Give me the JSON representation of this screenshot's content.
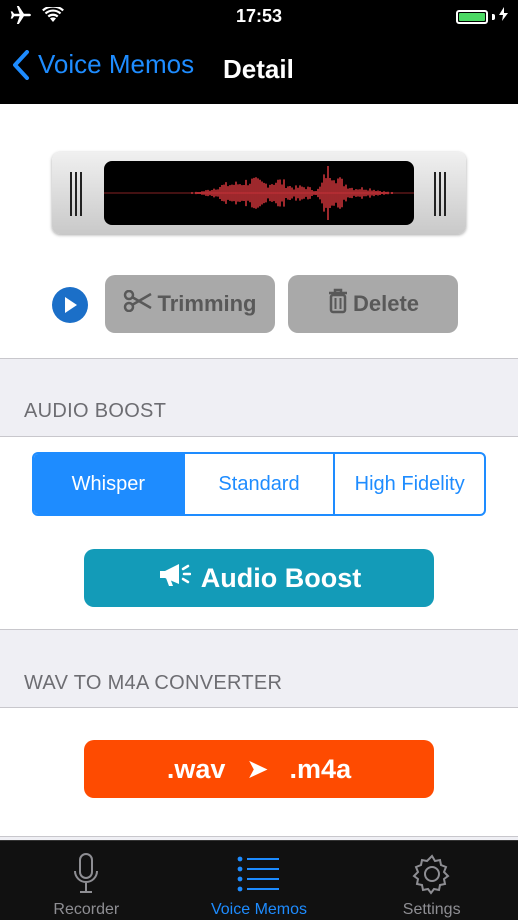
{
  "status_bar": {
    "time": "17:53"
  },
  "nav": {
    "back_label": "Voice Memos",
    "title": "Detail"
  },
  "controls": {
    "trim_label": "Trimming",
    "delete_label": "Delete"
  },
  "audio_boost": {
    "header": "AUDIO BOOST",
    "modes": [
      "Whisper",
      "Standard",
      "High Fidelity"
    ],
    "selected_mode": "Whisper",
    "button_label": "Audio Boost"
  },
  "converter": {
    "header": "WAV TO M4A CONVERTER",
    "from_label": ".wav",
    "arrow": "➤",
    "to_label": ".m4a"
  },
  "tabs": [
    {
      "label": "Recorder",
      "icon": "microphone-icon"
    },
    {
      "label": "Voice Memos",
      "icon": "list-icon",
      "active": true
    },
    {
      "label": "Settings",
      "icon": "gear-icon"
    }
  ],
  "colors": {
    "accent": "#1e8cff",
    "boost": "#139bb8",
    "convert": "#fe4b01",
    "waveform": "#e0393f",
    "battery": "#4cd964"
  }
}
